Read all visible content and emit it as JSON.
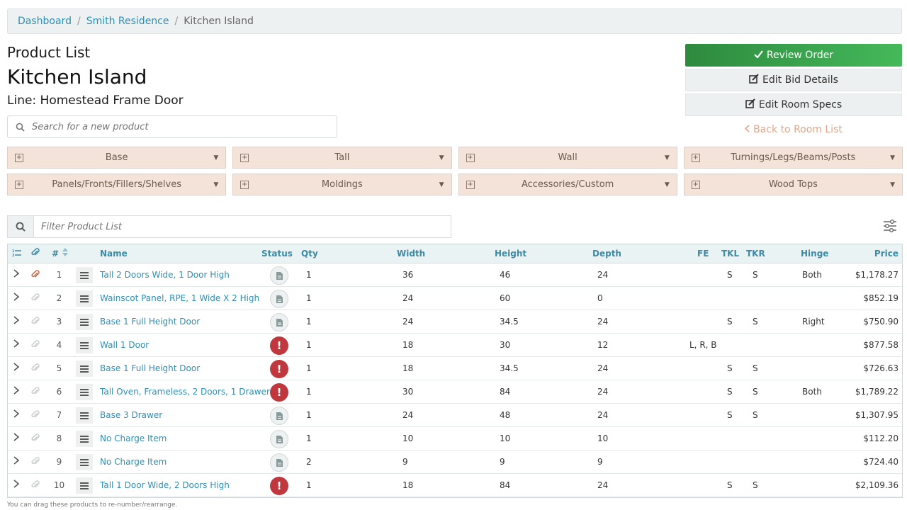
{
  "breadcrumb": [
    "Dashboard",
    "Smith Residence",
    "Kitchen Island"
  ],
  "page": {
    "kicker": "Product List",
    "title": "Kitchen Island",
    "line": "Line: Homestead Frame Door"
  },
  "search": {
    "placeholder": "Search for a new product"
  },
  "actions": {
    "review": "Review Order",
    "edit_bid": "Edit Bid Details",
    "edit_room": "Edit Room Specs",
    "back": "Back to Room List"
  },
  "categories": [
    "Base",
    "Tall",
    "Wall",
    "Turnings/Legs/Beams/Posts",
    "Panels/Fronts/Fillers/Shelves",
    "Moldings",
    "Accessories/Custom",
    "Wood Tops"
  ],
  "filter": {
    "placeholder": "Filter Product List"
  },
  "table": {
    "headers": {
      "num": "#",
      "name": "Name",
      "status": "Status",
      "qty": "Qty",
      "width": "Width",
      "height": "Height",
      "depth": "Depth",
      "fe": "FE",
      "tkl": "TKL",
      "tkr": "TKR",
      "hinge": "Hinge",
      "price": "Price"
    },
    "rows": [
      {
        "num": "1",
        "name": "Tall 2 Doors Wide, 1 Door High",
        "status": "doc",
        "qty": "1",
        "width": "36",
        "height": "46",
        "depth": "24",
        "fe": "",
        "tkl": "S",
        "tkr": "S",
        "hinge": "Both",
        "price": "$1,178.27",
        "attached": true
      },
      {
        "num": "2",
        "name": "Wainscot Panel, RPE, 1 Wide X 2 High",
        "status": "doc",
        "qty": "1",
        "width": "24",
        "height": "60",
        "depth": "0",
        "fe": "",
        "tkl": "",
        "tkr": "",
        "hinge": "",
        "price": "$852.19",
        "attached": false
      },
      {
        "num": "3",
        "name": "Base 1 Full Height Door",
        "status": "doc",
        "qty": "1",
        "width": "24",
        "height": "34.5",
        "depth": "24",
        "fe": "",
        "tkl": "S",
        "tkr": "S",
        "hinge": "Right",
        "price": "$750.90",
        "attached": false
      },
      {
        "num": "4",
        "name": "Wall 1 Door",
        "status": "error",
        "qty": "1",
        "width": "18",
        "height": "30",
        "depth": "12",
        "fe": "L, R, B",
        "tkl": "",
        "tkr": "",
        "hinge": "",
        "price": "$877.58",
        "attached": false
      },
      {
        "num": "5",
        "name": "Base 1 Full Height Door",
        "status": "error",
        "qty": "1",
        "width": "18",
        "height": "34.5",
        "depth": "24",
        "fe": "",
        "tkl": "S",
        "tkr": "S",
        "hinge": "",
        "price": "$726.63",
        "attached": false
      },
      {
        "num": "6",
        "name": "Tall Oven, Frameless, 2 Doors, 1 Drawer",
        "status": "error",
        "qty": "1",
        "width": "30",
        "height": "84",
        "depth": "24",
        "fe": "",
        "tkl": "S",
        "tkr": "S",
        "hinge": "Both",
        "price": "$1,789.22",
        "attached": false
      },
      {
        "num": "7",
        "name": "Base 3 Drawer",
        "status": "doc",
        "qty": "1",
        "width": "24",
        "height": "48",
        "depth": "24",
        "fe": "",
        "tkl": "S",
        "tkr": "S",
        "hinge": "",
        "price": "$1,307.95",
        "attached": false
      },
      {
        "num": "8",
        "name": "No Charge Item",
        "status": "doc",
        "qty": "1",
        "width": "10",
        "height": "10",
        "depth": "10",
        "fe": "",
        "tkl": "",
        "tkr": "",
        "hinge": "",
        "price": "$112.20",
        "attached": false
      },
      {
        "num": "9",
        "name": "No Charge Item",
        "status": "doc",
        "qty": "2",
        "width": "9",
        "height": "9",
        "depth": "9",
        "fe": "",
        "tkl": "",
        "tkr": "",
        "hinge": "",
        "price": "$724.40",
        "attached": false
      },
      {
        "num": "10",
        "name": "Tall 1 Door Wide, 2 Doors High",
        "status": "error",
        "qty": "1",
        "width": "18",
        "height": "84",
        "depth": "24",
        "fe": "",
        "tkl": "S",
        "tkr": "S",
        "hinge": "",
        "price": "$2,109.36",
        "attached": false
      }
    ]
  },
  "footnote": "You can drag these products to re-number/rearrange.",
  "colors": {
    "link": "#2e8fb5",
    "success": "#3aa84e",
    "error": "#c0383e",
    "category_bg": "#f3e3d8",
    "back_link": "#e2a58a"
  }
}
